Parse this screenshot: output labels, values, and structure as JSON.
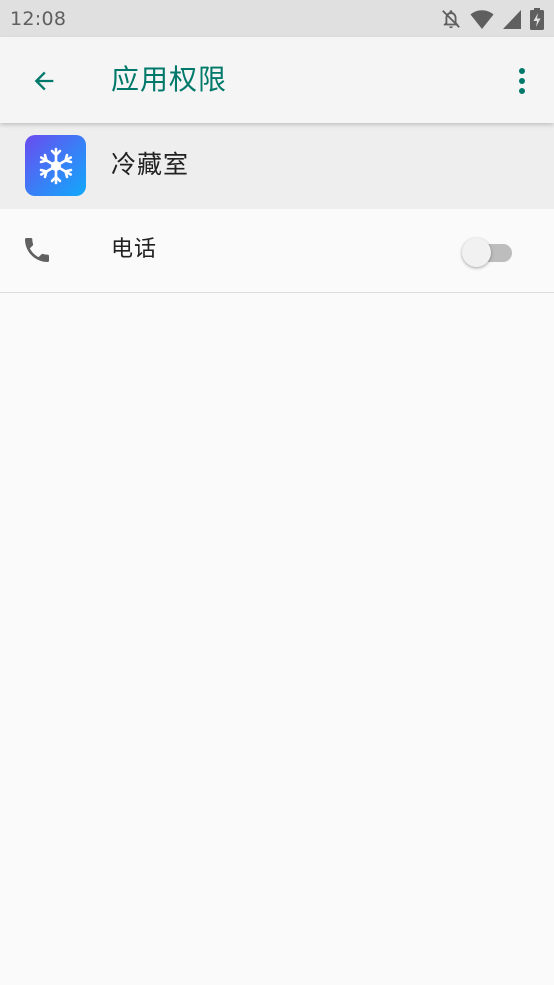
{
  "status_bar": {
    "time": "12:08",
    "icons": [
      "notifications-off-icon",
      "wifi-icon",
      "cell-signal-icon",
      "battery-charging-icon"
    ]
  },
  "app_bar": {
    "back_icon": "arrow-back-icon",
    "title": "应用权限",
    "more_icon": "more-vert-icon"
  },
  "app_header": {
    "icon": "snowflake-icon",
    "name": "冷藏室"
  },
  "permissions": [
    {
      "icon": "phone-icon",
      "label": "电话",
      "enabled": false
    }
  ],
  "colors": {
    "accent": "#00796b",
    "status_bar_bg": "#e0e0e0",
    "app_bar_bg": "#f5f5f5",
    "header_row_bg": "#eeeeee",
    "page_bg": "#fafafa",
    "app_icon_gradient": [
      "#6a4bf0",
      "#11a9fb"
    ]
  }
}
